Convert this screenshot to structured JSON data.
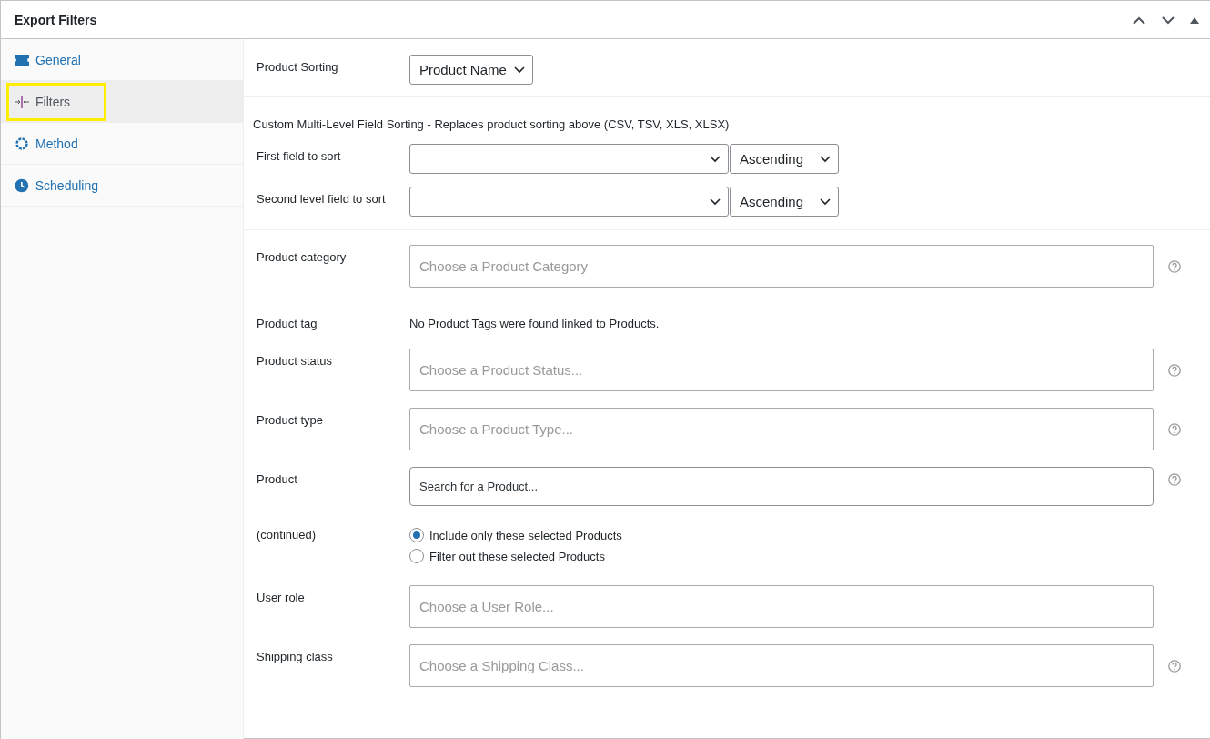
{
  "panel": {
    "title": "Export Filters"
  },
  "header_controls": [
    {
      "kind": "up"
    },
    {
      "kind": "down"
    },
    {
      "kind": "collapse"
    }
  ],
  "tabs": [
    {
      "label": "General",
      "kind": "ticket",
      "selected": false,
      "highlighted": false
    },
    {
      "label": "Filters",
      "kind": "filter",
      "selected": true,
      "highlighted": true
    },
    {
      "label": "Method",
      "kind": "gear",
      "selected": false,
      "highlighted": false
    },
    {
      "label": "Scheduling",
      "kind": "clock",
      "selected": false,
      "highlighted": false
    }
  ],
  "sections": [
    {
      "rows": [
        {
          "kind": "select",
          "label": "Product Sorting",
          "value": "Product Name"
        }
      ]
    },
    {
      "rows": [
        {
          "kind": "note",
          "text": "Custom Multi-Level Field Sorting - Replaces product sorting above (CSV, TSV, XLS, XLSX)"
        },
        {
          "kind": "sort",
          "label": "First field to sort",
          "order": "Ascending"
        },
        {
          "kind": "sort",
          "label": "Second level field to sort",
          "order": "Ascending"
        }
      ]
    },
    {
      "rows": [
        {
          "kind": "multiselect",
          "label": "Product category",
          "placeholder": "Choose a Product Category",
          "help": true
        },
        {
          "kind": "text",
          "label": "Product tag",
          "text": "No Product Tags were found linked to Products."
        },
        {
          "kind": "multiselect",
          "label": "Product status",
          "placeholder": "Choose a Product Status...",
          "help": true
        },
        {
          "kind": "multiselect",
          "label": "Product type",
          "placeholder": "Choose a Product Type...",
          "help": true
        },
        {
          "kind": "search",
          "label": "Product",
          "placeholder": "Search for a Product...",
          "help": true
        },
        {
          "kind": "radio",
          "label": "(continued)",
          "options": [
            {
              "label": "Include only these selected Products",
              "selected": true
            },
            {
              "label": "Filter out these selected Products",
              "selected": false
            }
          ]
        },
        {
          "kind": "multiselect",
          "label": "User role",
          "placeholder": "Choose a User Role...",
          "help": false
        },
        {
          "kind": "multiselect",
          "label": "Shipping class",
          "placeholder": "Choose a Shipping Class...",
          "help": true
        }
      ]
    }
  ]
}
